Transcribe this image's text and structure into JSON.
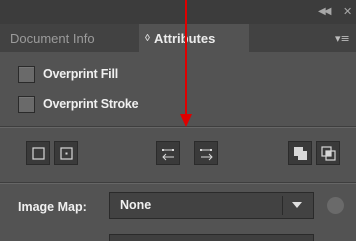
{
  "panel": {
    "tabs": [
      {
        "label": "Document Info",
        "active": false
      },
      {
        "label": "Attributes",
        "active": true
      }
    ]
  },
  "checkboxes": [
    {
      "label": "Overprint Fill",
      "checked": false
    },
    {
      "label": "Overprint Stroke",
      "checked": false
    }
  ],
  "icon_buttons": [
    {
      "name": "show-center-off",
      "icon": "square-icon"
    },
    {
      "name": "show-center-on",
      "icon": "square-dot-icon"
    },
    {
      "name": "reverse-path-direction-off",
      "icon": "arrow-left-path-icon"
    },
    {
      "name": "reverse-path-direction-on",
      "icon": "arrow-right-path-icon"
    },
    {
      "name": "use-non-zero-winding-rule",
      "icon": "nonzero-fill-icon"
    },
    {
      "name": "use-even-odd-rule",
      "icon": "evenodd-fill-icon"
    }
  ],
  "image_map": {
    "label": "Image Map:",
    "selected": "None"
  },
  "colors": {
    "panel_bg": "#535353",
    "tab_bar_bg": "#424242",
    "annotation": "#e00000"
  }
}
